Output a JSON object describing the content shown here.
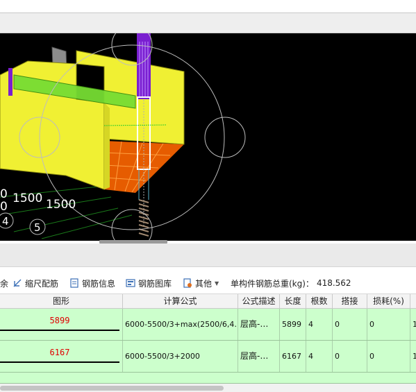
{
  "viewport": {
    "axis_labels": [
      "0",
      "1500",
      "1500",
      "0"
    ],
    "axis_numbers": [
      "4",
      "5"
    ]
  },
  "toolbar": {
    "partial_left": "余",
    "scale_rebar": "缩尺配筋",
    "rebar_info": "钢筋信息",
    "rebar_library": "钢筋图库",
    "other": "其他",
    "total_weight_label": "单构件钢筋总重(kg)：",
    "total_weight_value": "418.562"
  },
  "table": {
    "columns": [
      "图形",
      "计算公式",
      "公式描述",
      "长度",
      "根数",
      "搭接",
      "损耗(%)"
    ],
    "rows": [
      {
        "shape_value": "5899",
        "formula": "6000-5500/3+max(2500/6,4…",
        "description": "层高-…",
        "length": "5899",
        "count": "4",
        "lap": "0",
        "loss": "0",
        "extra": "1"
      },
      {
        "shape_value": "6167",
        "formula": "6000-5500/3+2000",
        "description": "层高-…",
        "length": "6167",
        "count": "4",
        "lap": "0",
        "loss": "0",
        "extra": "1"
      }
    ]
  },
  "colors": {
    "row_bg": "#ccffcc",
    "shape_value": "#e00000",
    "beam_yellow": "#f0f033",
    "viewport_bg": "#000000"
  }
}
